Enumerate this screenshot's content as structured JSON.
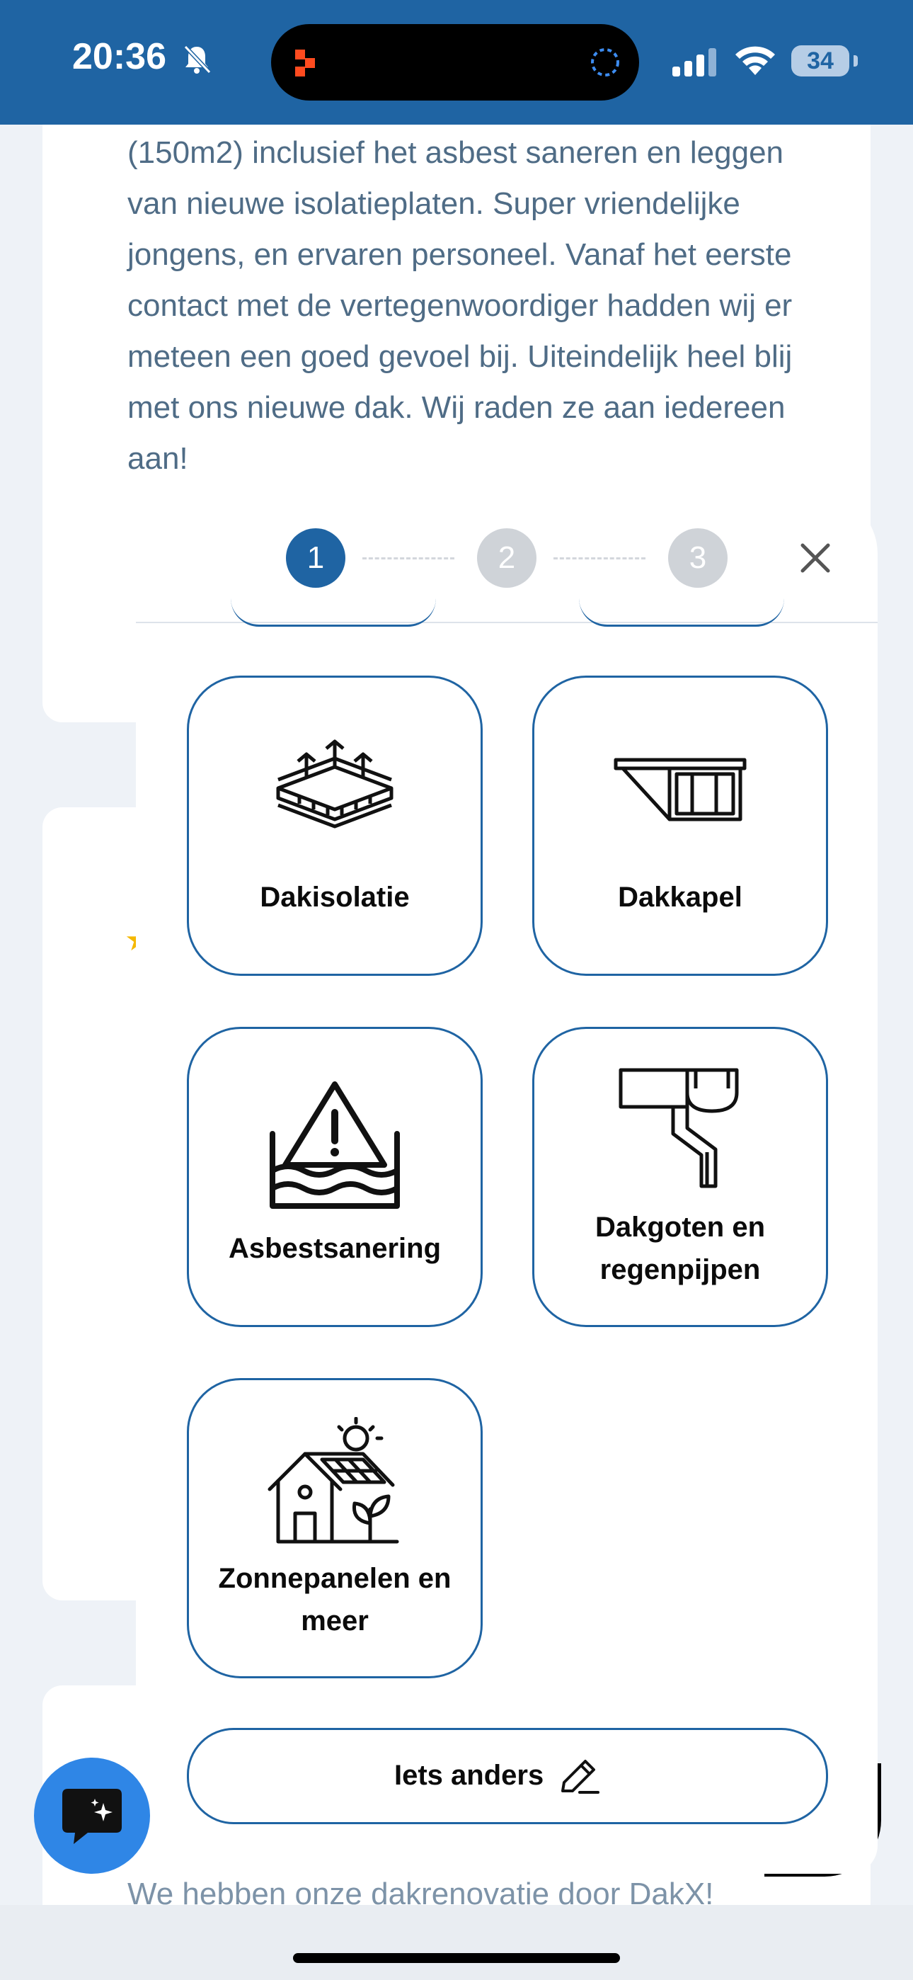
{
  "status_bar": {
    "time": "20:36",
    "battery": "34"
  },
  "background": {
    "review_text": "(150m2) inclusief het asbest saneren en leggen van nieuwe isolatieplaten. Super vriendelijke jongens, en ervaren personeel. Vanaf het eerste contact met de vertegenwoordiger hadden wij er meteen een goed gevoel bij. Uiteindelijk heel blij met ons nieuwe dak. Wij raden ze aan iedereen aan!",
    "bottom_text": "We hebben onze dakrenovatie door DakX!"
  },
  "wizard": {
    "steps": [
      "1",
      "2",
      "3"
    ],
    "active_step": 1,
    "options": [
      {
        "label": "Dakisolatie",
        "icon": "roof-insulation-icon"
      },
      {
        "label": "Dakkapel",
        "icon": "dormer-icon"
      },
      {
        "label": "Asbestsanering",
        "icon": "asbestos-warning-icon"
      },
      {
        "label": "Dakgoten en regenpijpen",
        "icon": "gutter-downpipe-icon"
      },
      {
        "label": "Zonnepanelen en meer",
        "icon": "solar-house-icon"
      }
    ],
    "other_label": "Iets anders"
  },
  "colors": {
    "brand_blue": "#1f64a3",
    "status_bar": "#1f64a3",
    "chat_button": "#2f86e6",
    "step_inactive": "#cfd3d8"
  }
}
